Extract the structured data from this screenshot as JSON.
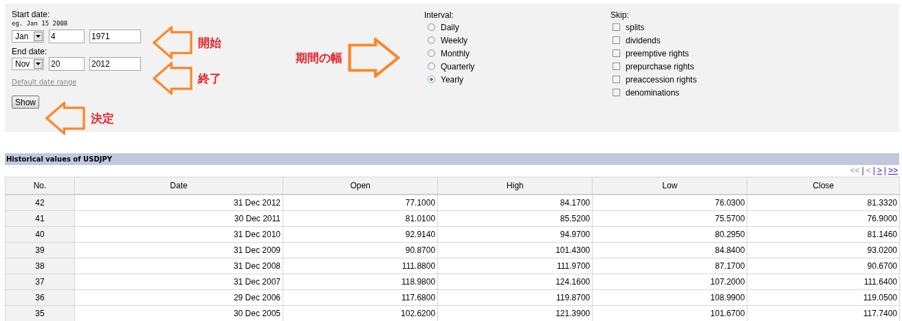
{
  "form": {
    "start": {
      "label": "Start date:",
      "hint": "eg. Jan 15 2008",
      "month": "Jan",
      "day": "4",
      "year": "1971"
    },
    "end": {
      "label": "End date:",
      "month": "Nov",
      "day": "20",
      "year": "2012"
    },
    "default_link": "Default date range",
    "show_button": "Show",
    "interval": {
      "label": "Interval:",
      "options": [
        {
          "label": "Daily",
          "selected": false
        },
        {
          "label": "Weekly",
          "selected": false
        },
        {
          "label": "Monthly",
          "selected": false
        },
        {
          "label": "Quarterly",
          "selected": false
        },
        {
          "label": "Yearly",
          "selected": true
        }
      ]
    },
    "skip": {
      "label": "Skip:",
      "options": [
        {
          "label": "splits",
          "checked": false
        },
        {
          "label": "dividends",
          "checked": false
        },
        {
          "label": "preemptive rights",
          "checked": false
        },
        {
          "label": "prepurchase rights",
          "checked": false
        },
        {
          "label": "preaccession rights",
          "checked": false
        },
        {
          "label": "denominations",
          "checked": false
        }
      ]
    }
  },
  "annotations": [
    {
      "text": "開始",
      "kind": "left"
    },
    {
      "text": "終了",
      "kind": "left"
    },
    {
      "text": "期間の幅",
      "kind": "right"
    },
    {
      "text": "決定",
      "kind": "left"
    }
  ],
  "table": {
    "title": "Historical values of USDJPY",
    "pager": [
      {
        "kind": "link",
        "label": "<<",
        "disabled": true
      },
      {
        "kind": "separator",
        "label": "|"
      },
      {
        "kind": "link",
        "label": "<",
        "disabled": true
      },
      {
        "kind": "separator",
        "label": "|"
      },
      {
        "kind": "link",
        "label": ">",
        "disabled": false
      },
      {
        "kind": "separator",
        "label": "|"
      },
      {
        "kind": "link",
        "label": ">>",
        "disabled": false
      }
    ],
    "columns": [
      "No.",
      "Date",
      "Open",
      "High",
      "Low",
      "Close"
    ],
    "rows": [
      [
        "42",
        "31 Dec 2012",
        "77.1000",
        "84.1700",
        "76.0300",
        "81.3320"
      ],
      [
        "41",
        "30 Dec 2011",
        "81.0100",
        "85.5200",
        "75.5700",
        "76.9000"
      ],
      [
        "40",
        "31 Dec 2010",
        "92.9140",
        "94.9700",
        "80.2950",
        "81.1460"
      ],
      [
        "39",
        "31 Dec 2009",
        "90.8700",
        "101.4300",
        "84.8400",
        "93.0200"
      ],
      [
        "38",
        "31 Dec 2008",
        "111.8800",
        "111.9700",
        "87.1700",
        "90.6700"
      ],
      [
        "37",
        "31 Dec 2007",
        "118.9800",
        "124.1600",
        "107.2000",
        "111.6400"
      ],
      [
        "36",
        "29 Dec 2006",
        "117.6800",
        "119.8700",
        "108.9900",
        "119.0500"
      ],
      [
        "35",
        "30 Dec 2005",
        "102.6200",
        "121.3900",
        "101.6700",
        "117.7400"
      ]
    ]
  }
}
